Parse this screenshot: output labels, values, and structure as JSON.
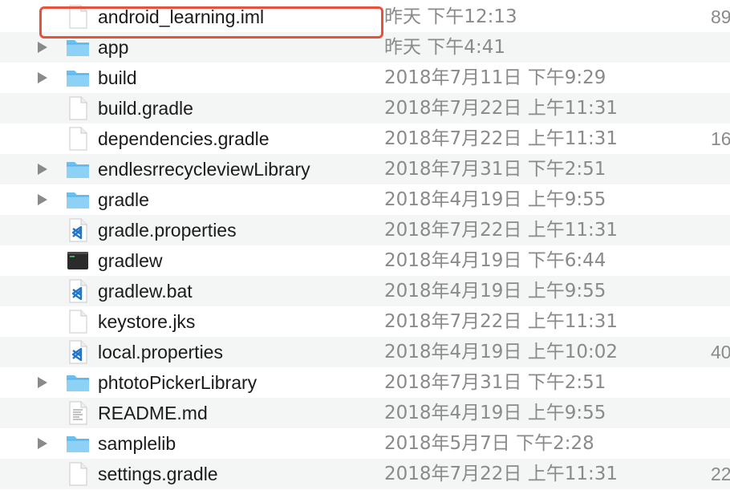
{
  "files": [
    {
      "name": "android_learning.iml",
      "date": "昨天 下午12:13",
      "size": "89",
      "kind": "file",
      "folder": false
    },
    {
      "name": "app",
      "date": "昨天 下午4:41",
      "size": "",
      "kind": "folder",
      "folder": true
    },
    {
      "name": "build",
      "date": "2018年7月11日 下午9:29",
      "size": "",
      "kind": "folder",
      "folder": true
    },
    {
      "name": "build.gradle",
      "date": "2018年7月22日 上午11:31",
      "size": "",
      "kind": "file",
      "folder": false
    },
    {
      "name": "dependencies.gradle",
      "date": "2018年7月22日 上午11:31",
      "size": "16",
      "kind": "file",
      "folder": false
    },
    {
      "name": "endlesrrecycleviewLibrary",
      "date": "2018年7月31日 下午2:51",
      "size": "",
      "kind": "folder",
      "folder": true
    },
    {
      "name": "gradle",
      "date": "2018年4月19日 上午9:55",
      "size": "",
      "kind": "folder",
      "folder": true
    },
    {
      "name": "gradle.properties",
      "date": "2018年7月22日 上午11:31",
      "size": "",
      "kind": "vscode",
      "folder": false
    },
    {
      "name": "gradlew",
      "date": "2018年4月19日 下午6:44",
      "size": "",
      "kind": "terminal",
      "folder": false
    },
    {
      "name": "gradlew.bat",
      "date": "2018年4月19日 上午9:55",
      "size": "",
      "kind": "vscode",
      "folder": false
    },
    {
      "name": "keystore.jks",
      "date": "2018年7月22日 上午11:31",
      "size": "",
      "kind": "file",
      "folder": false
    },
    {
      "name": "local.properties",
      "date": "2018年4月19日 上午10:02",
      "size": "40",
      "kind": "vscode",
      "folder": false
    },
    {
      "name": "phtotoPickerLibrary",
      "date": "2018年7月31日 下午2:51",
      "size": "",
      "kind": "folder",
      "folder": true
    },
    {
      "name": "README.md",
      "date": "2018年4月19日 上午9:55",
      "size": "",
      "kind": "text",
      "folder": false
    },
    {
      "name": "samplelib",
      "date": "2018年5月7日 下午2:28",
      "size": "",
      "kind": "folder",
      "folder": true
    },
    {
      "name": "settings.gradle",
      "date": "2018年7月22日 上午11:31",
      "size": "22",
      "kind": "file",
      "folder": false
    }
  ],
  "colors": {
    "highlight": "#e8513a",
    "folder": "#6cc0f0",
    "row_alt": "#f4f5f5",
    "date_text": "#8a8a8a"
  }
}
